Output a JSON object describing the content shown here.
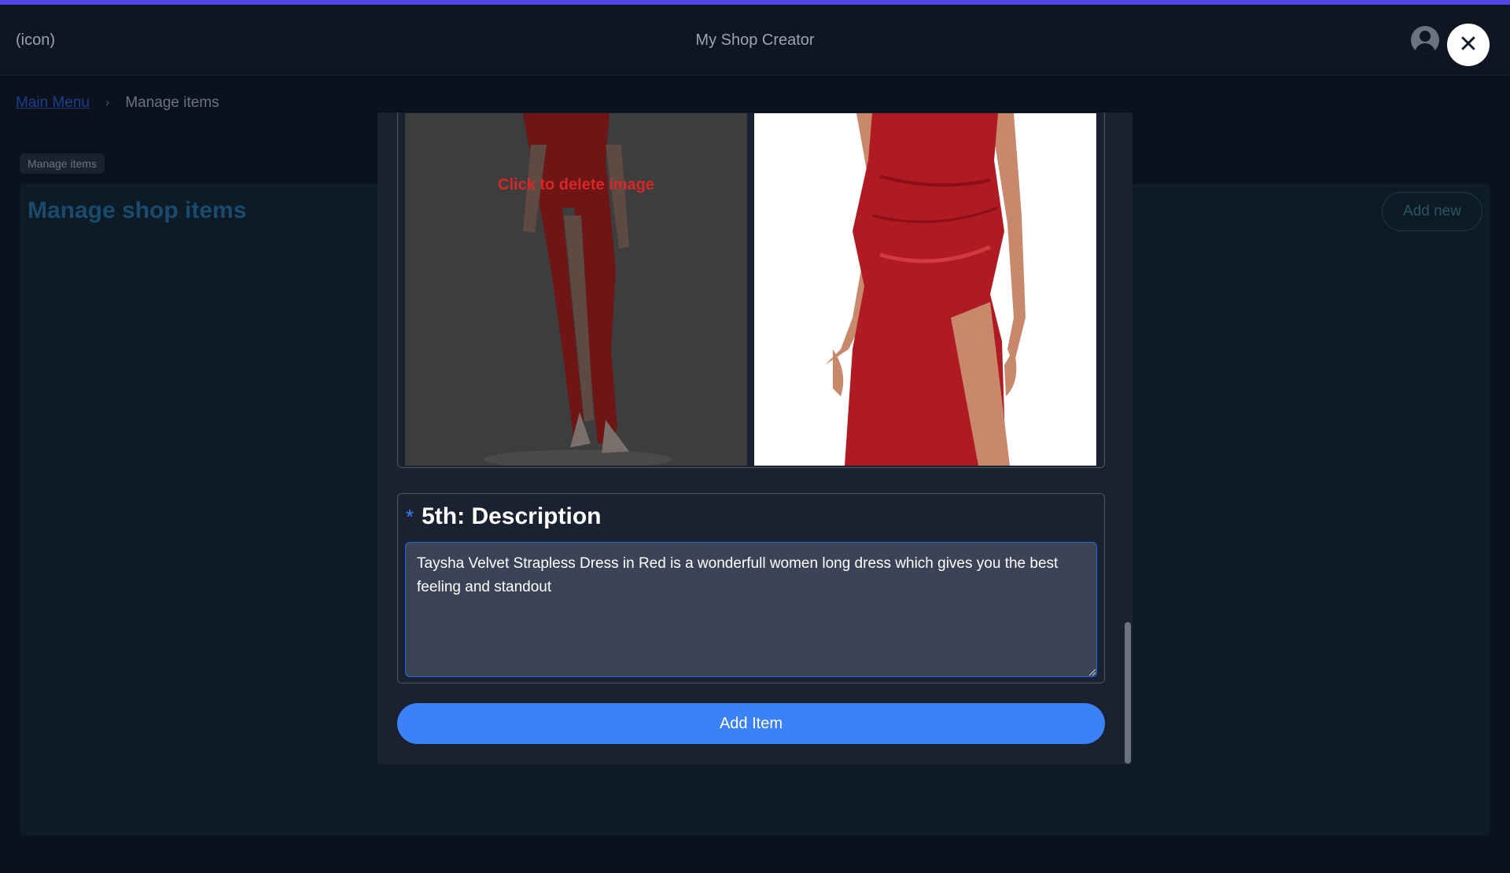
{
  "header": {
    "icon_placeholder": "(icon)",
    "app_title": "My Shop Creator",
    "close_symbol": "✕"
  },
  "breadcrumb": {
    "main_menu": "Main Menu",
    "separator": "›",
    "current": "Manage items"
  },
  "page": {
    "tag": "Manage items",
    "title": "Manage shop items",
    "add_new_label": "Add new"
  },
  "modal": {
    "delete_image_label": "Click to delete image",
    "description": {
      "required_mark": "*",
      "title": "5th: Description",
      "value": "Taysha Velvet Strapless Dress in Red is a wonderfull women long dress which gives you the best feeling and standout"
    },
    "add_item_label": "Add Item"
  },
  "colors": {
    "accent_bar": "#4f46e5",
    "primary_button": "#3b82f6",
    "delete_text": "#dc2626",
    "dress_red": "#b01a22"
  }
}
